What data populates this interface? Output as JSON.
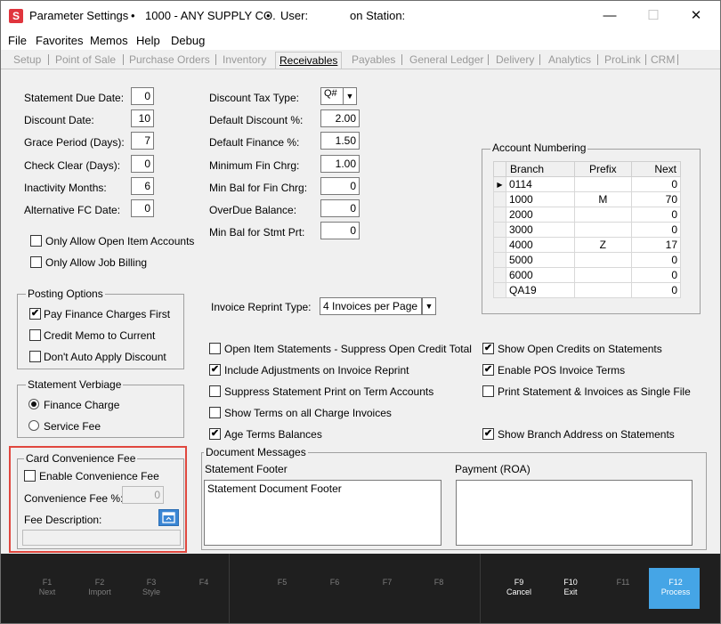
{
  "titlebar": {
    "app_icon": "S",
    "title": "Parameter Settings",
    "bullet1": "•",
    "company": "1000 - ANY SUPPLY CO.",
    "bullet2": "•",
    "user_label": "User:",
    "station_label": "on Station:",
    "minimize": "—",
    "maximize": "☐",
    "close": "✕"
  },
  "menu": [
    "File",
    "Favorites",
    "Memos",
    "Help",
    "Debug"
  ],
  "tabs": [
    "Setup",
    "Point of Sale",
    "Purchase Orders",
    "Inventory",
    "Receivables",
    "Payables",
    "General Ledger",
    "Delivery",
    "Analytics",
    "ProLink",
    "CRM"
  ],
  "left_fields": [
    {
      "label": "Statement Due Date:",
      "value": "0"
    },
    {
      "label": "Discount Date:",
      "value": "10"
    },
    {
      "label": "Grace Period (Days):",
      "value": "7"
    },
    {
      "label": "Check Clear (Days):",
      "value": "0"
    },
    {
      "label": "Inactivity Months:",
      "value": "6"
    },
    {
      "label": "Alternative FC Date:",
      "value": "0"
    }
  ],
  "left_checks": [
    {
      "label": "Only Allow Open Item Accounts",
      "checked": false
    },
    {
      "label": "Only Allow Job Billing",
      "checked": false
    }
  ],
  "mid_fields": [
    {
      "label": "Discount Tax Type:",
      "value": "Q#"
    },
    {
      "label": "Default Discount %:",
      "value": "2.00"
    },
    {
      "label": "Default Finance %:",
      "value": "1.50"
    },
    {
      "label": "Minimum Fin Chrg:",
      "value": "1.00"
    },
    {
      "label": "Min Bal for Fin Chrg:",
      "value": "0"
    },
    {
      "label": "OverDue Balance:",
      "value": "0"
    },
    {
      "label": "Min Bal for Stmt Prt:",
      "value": "0"
    }
  ],
  "account_numbering": {
    "title": "Account Numbering",
    "headers": [
      "Branch",
      "Prefix",
      "Next"
    ],
    "current_marker": "▶",
    "rows": [
      {
        "branch": "0114",
        "prefix": "",
        "next": "0"
      },
      {
        "branch": "1000",
        "prefix": "M",
        "next": "70"
      },
      {
        "branch": "2000",
        "prefix": "",
        "next": "0"
      },
      {
        "branch": "3000",
        "prefix": "",
        "next": "0"
      },
      {
        "branch": "4000",
        "prefix": "Z",
        "next": "17"
      },
      {
        "branch": "5000",
        "prefix": "",
        "next": "0"
      },
      {
        "branch": "6000",
        "prefix": "",
        "next": "0"
      },
      {
        "branch": "QA19",
        "prefix": "",
        "next": "0"
      }
    ]
  },
  "posting_options": {
    "title": "Posting Options",
    "items": [
      {
        "label": "Pay Finance Charges First",
        "checked": true
      },
      {
        "label": "Credit Memo to Current",
        "checked": false
      },
      {
        "label": "Don't Auto Apply Discount",
        "checked": false
      }
    ]
  },
  "invoice_reprint": {
    "label": "Invoice Reprint Type:",
    "value": "4 Invoices per Page"
  },
  "statement_verbiage": {
    "title": "Statement Verbiage",
    "options": [
      {
        "label": "Finance Charge",
        "selected": true
      },
      {
        "label": "Service Fee",
        "selected": false
      }
    ]
  },
  "mid_checks": [
    {
      "label": "Open Item Statements - Suppress Open Credit Total",
      "checked": false
    },
    {
      "label": "Include Adjustments on Invoice Reprint",
      "checked": true
    },
    {
      "label": "Suppress Statement Print on Term Accounts",
      "checked": false
    },
    {
      "label": "Show Terms on all Charge Invoices",
      "checked": false
    },
    {
      "label": "Age Terms Balances",
      "checked": true
    }
  ],
  "right_checks": [
    {
      "label": "Show Open Credits on Statements",
      "checked": true
    },
    {
      "label": "Enable POS Invoice Terms",
      "checked": true
    },
    {
      "label": "Print Statement & Invoices as Single File",
      "checked": false
    },
    {
      "label": "Show Branch Address on Statements",
      "checked": true
    }
  ],
  "card_fee": {
    "title": "Card Convenience Fee",
    "enable_label": "Enable Convenience Fee",
    "enabled": false,
    "fee_label": "Convenience Fee %:",
    "fee_value": "0",
    "desc_label": "Fee Description:",
    "desc_value": "",
    "desc_button_icon": "popup-edit-icon"
  },
  "document_messages": {
    "title": "Document Messages",
    "statement_footer_label": "Statement Footer",
    "statement_footer_value": "Statement Document Footer",
    "payment_label": "Payment (ROA)",
    "payment_value": ""
  },
  "fkeys": [
    {
      "key": "F1",
      "label": "Next",
      "active": false
    },
    {
      "key": "F2",
      "label": "Import",
      "active": false
    },
    {
      "key": "F3",
      "label": "Style",
      "active": false
    },
    {
      "key": "F4",
      "label": "",
      "active": false
    },
    {
      "key": "F5",
      "label": "",
      "active": false
    },
    {
      "key": "F6",
      "label": "",
      "active": false
    },
    {
      "key": "F7",
      "label": "",
      "active": false
    },
    {
      "key": "F8",
      "label": "",
      "active": false
    },
    {
      "key": "F9",
      "label": "Cancel",
      "active": true
    },
    {
      "key": "F10",
      "label": "Exit",
      "active": true
    },
    {
      "key": "F11",
      "label": "",
      "active": false
    },
    {
      "key": "F12",
      "label": "Process",
      "active": true
    }
  ],
  "colors": {
    "highlight_box": "#e0473e",
    "f12_button": "#45a5e6",
    "footer_bg": "#1f1f1f"
  }
}
